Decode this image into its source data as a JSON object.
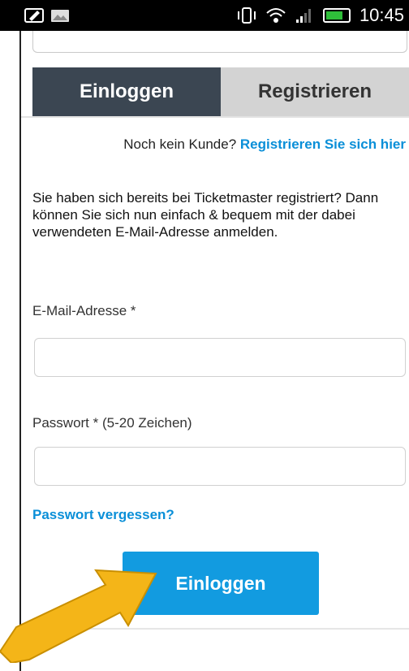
{
  "statusbar": {
    "time": "10:45",
    "icons": [
      "edit-icon",
      "image-icon",
      "vibrate-icon",
      "wifi-icon",
      "signal-icon",
      "battery-icon"
    ]
  },
  "tabs": [
    {
      "label": "Einloggen",
      "active": true
    },
    {
      "label": "Registrieren",
      "active": false
    }
  ],
  "hint": {
    "prefix": "Noch kein Kunde?",
    "link": "Registrieren Sie sich hier"
  },
  "intro": "Sie haben sich bereits bei Ticketmaster registriert? Dann können Sie sich nun einfach & bequem mit der dabei verwendeten E-Mail-Adresse anmelden.",
  "form": {
    "email_label": "E-Mail-Adresse *",
    "email_value": "",
    "password_label": "Passwort * (5-20 Zeichen)",
    "password_value": "",
    "forgot": "Passwort vergessen?",
    "submit": "Einloggen"
  },
  "colors": {
    "accent": "#129be0",
    "link": "#0a8fd8",
    "tab_active_bg": "#3b4652",
    "tab_inactive_bg": "#d3d3d3",
    "arrow": "#f4b518"
  }
}
